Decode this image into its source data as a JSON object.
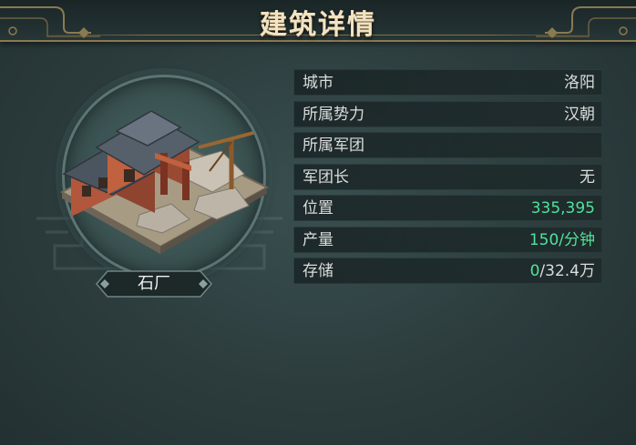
{
  "header": {
    "title": "建筑详情"
  },
  "building": {
    "name": "石厂",
    "icon": "quarry-building-icon"
  },
  "info_rows": [
    {
      "label": "城市",
      "value": "洛阳"
    },
    {
      "label": "所属势力",
      "value": "汉朝"
    },
    {
      "label": "所属军团",
      "value": ""
    },
    {
      "label": "军团长",
      "value": "无"
    },
    {
      "label": "位置",
      "value": "335,395"
    },
    {
      "label": "产量",
      "value": "150/分钟"
    },
    {
      "label": "存储",
      "value_current": "0",
      "value_max": "/32.4万"
    }
  ],
  "colors": {
    "background": "#2f4142",
    "title_text": "#f2e3c2",
    "highlight_value": "#4fe39a",
    "row_background": "#1b2728"
  }
}
